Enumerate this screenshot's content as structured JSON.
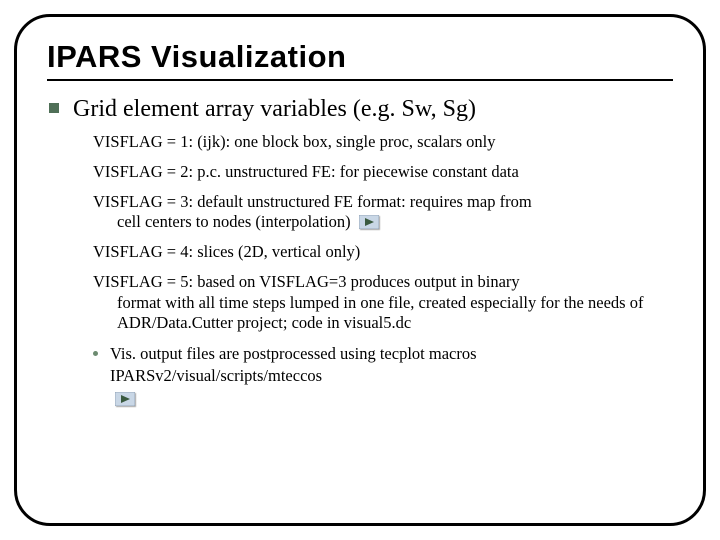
{
  "title": "IPARS Visualization",
  "main_bullet": "Grid element array variables (e.g. Sw, Sg)",
  "items": [
    {
      "text": "VISFLAG = 1: (ijk): one block box, single proc, scalars only",
      "cont": null,
      "arrow": false
    },
    {
      "text": "VISFLAG = 2: p.c. unstructured FE: for piecewise constant data",
      "cont": null,
      "arrow": false
    },
    {
      "text": "VISFLAG = 3: default unstructured FE format: requires map from",
      "cont": "cell centers to nodes (interpolation)",
      "arrow": true
    },
    {
      "text": "VISFLAG = 4: slices (2D, vertical only)",
      "cont": null,
      "arrow": false
    },
    {
      "text": "VISFLAG = 5: based on VISFLAG=3 produces output in binary",
      "cont": "format with all time steps lumped in one file, created especially for the needs of ADR/Data.Cutter project; code in visual5.dc",
      "arrow": false
    }
  ],
  "sub_bullet": {
    "line1": "Vis. output files are postprocessed using tecplot macros",
    "line2": "IPARSv2/visual/scripts/mteccos"
  }
}
